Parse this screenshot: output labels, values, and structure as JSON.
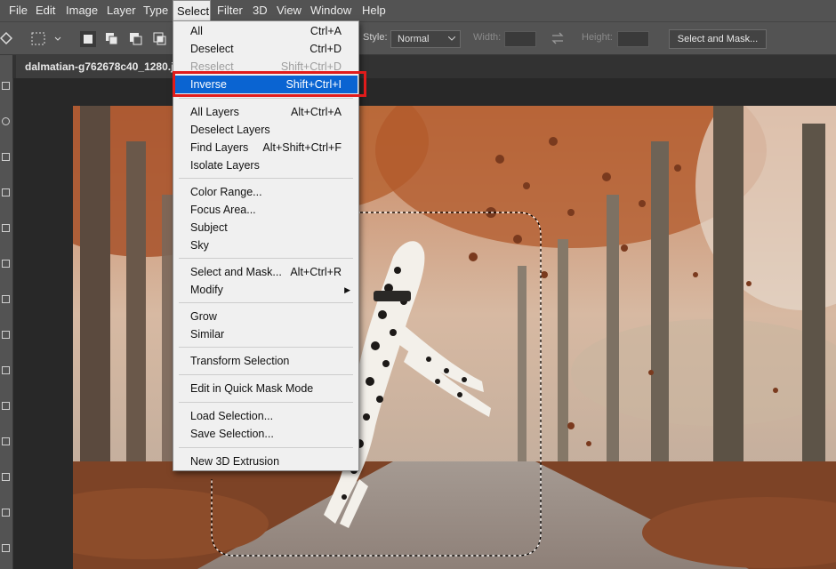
{
  "menubar": {
    "items": [
      "File",
      "Edit",
      "Image",
      "Layer",
      "Type",
      "Select",
      "Filter",
      "3D",
      "View",
      "Window",
      "Help"
    ],
    "active": "Select"
  },
  "options": {
    "style_label": "Style:",
    "style_value": "Normal",
    "width_label": "Width:",
    "height_label": "Height:",
    "select_and_mask": "Select and Mask..."
  },
  "document": {
    "tab_title": "dalmatian-g762678c40_1280.jp"
  },
  "select_menu": {
    "items": [
      {
        "label": "All",
        "shortcut": "Ctrl+A"
      },
      {
        "label": "Deselect",
        "shortcut": "Ctrl+D"
      },
      {
        "label": "Reselect",
        "shortcut": "Shift+Ctrl+D",
        "disabled": true
      },
      {
        "label": "Inverse",
        "shortcut": "Shift+Ctrl+I",
        "highlighted": true
      },
      {
        "label": "All Layers",
        "shortcut": "Alt+Ctrl+A"
      },
      {
        "label": "Deselect Layers",
        "shortcut": ""
      },
      {
        "label": "Find Layers",
        "shortcut": "Alt+Shift+Ctrl+F"
      },
      {
        "label": "Isolate Layers",
        "shortcut": ""
      },
      {
        "label": "Color Range...",
        "shortcut": ""
      },
      {
        "label": "Focus Area...",
        "shortcut": ""
      },
      {
        "label": "Subject",
        "shortcut": ""
      },
      {
        "label": "Sky",
        "shortcut": ""
      },
      {
        "label": "Select and Mask...",
        "shortcut": "Alt+Ctrl+R"
      },
      {
        "label": "Modify",
        "shortcut": "",
        "submenu": true
      },
      {
        "label": "Grow",
        "shortcut": ""
      },
      {
        "label": "Similar",
        "shortcut": ""
      },
      {
        "label": "Transform Selection",
        "shortcut": ""
      },
      {
        "label": "Edit in Quick Mask Mode",
        "shortcut": ""
      },
      {
        "label": "Load Selection...",
        "shortcut": ""
      },
      {
        "label": "Save Selection...",
        "shortcut": ""
      },
      {
        "label": "New 3D Extrusion",
        "shortcut": ""
      }
    ]
  },
  "colors": {
    "ui_dark": "#535353",
    "menu_bg": "#f0f0f0",
    "highlight": "#0a64d2",
    "annotation_red": "#e01b1b"
  },
  "icons": [
    "move-tool-icon",
    "marquee-tool-icon",
    "new-selection-icon",
    "add-to-selection-icon",
    "subtract-selection-icon",
    "intersect-selection-icon",
    "swap-icon",
    "submenu-arrow-icon"
  ]
}
